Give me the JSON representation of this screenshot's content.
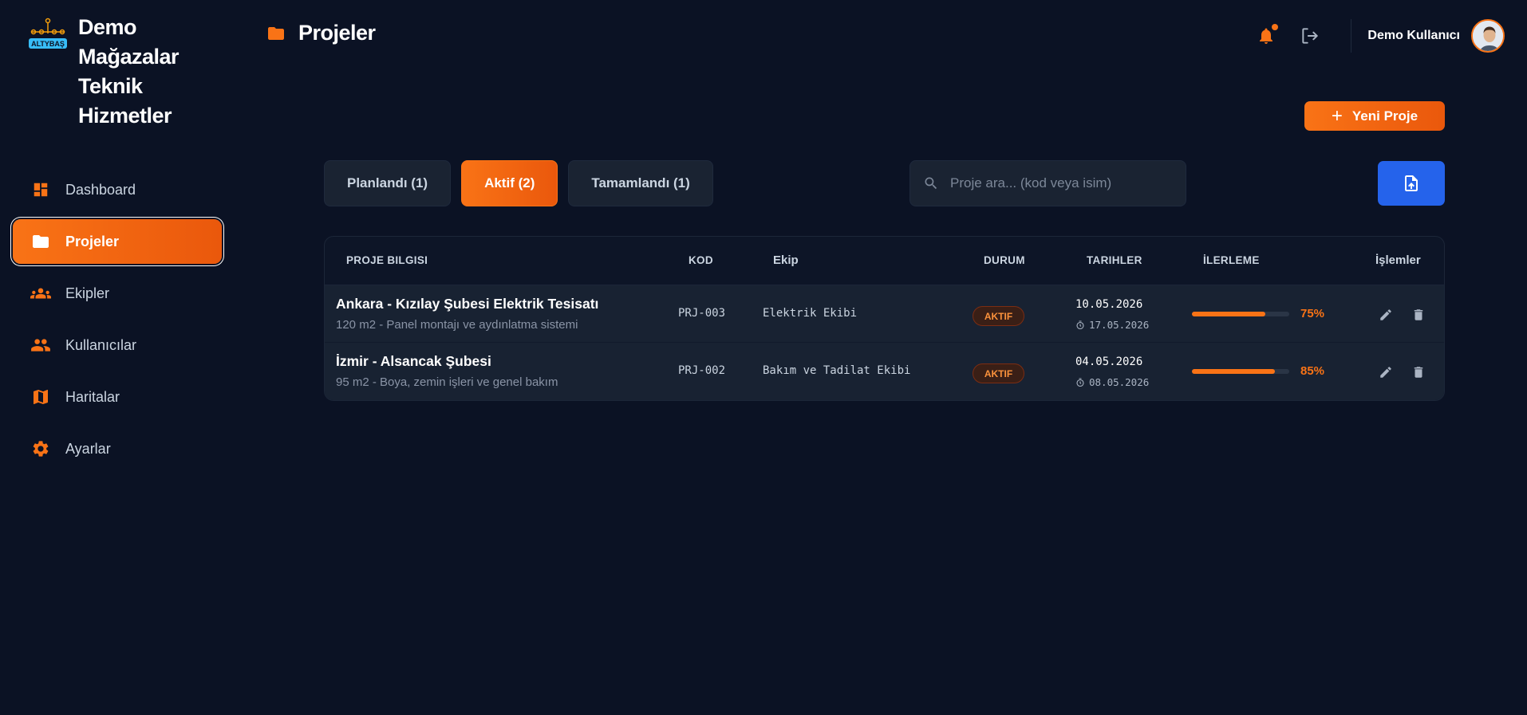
{
  "sidebar": {
    "logo_text": "ALTYBAŞ",
    "brand": "Demo Mağazalar Teknik Hizmetler",
    "items": [
      {
        "label": "Dashboard",
        "icon": "dashboard-icon",
        "active": false
      },
      {
        "label": "Projeler",
        "icon": "folder-icon",
        "active": true
      },
      {
        "label": "Ekipler",
        "icon": "groups-icon",
        "active": false
      },
      {
        "label": "Kullanıcılar",
        "icon": "people-icon",
        "active": false
      },
      {
        "label": "Haritalar",
        "icon": "map-icon",
        "active": false
      },
      {
        "label": "Ayarlar",
        "icon": "gear-icon",
        "active": false
      }
    ]
  },
  "header": {
    "title": "Projeler",
    "title_icon": "folder-icon",
    "user_name": "Demo Kullanıcı"
  },
  "main": {
    "new_button": "Yeni Proje",
    "tabs": [
      {
        "label": "Planlandı (1)",
        "active": false
      },
      {
        "label": "Aktif (2)",
        "active": true
      },
      {
        "label": "Tamamlandı (1)",
        "active": false
      }
    ],
    "search_placeholder": "Proje ara... (kod veya isim)",
    "table": {
      "headers": [
        "PROJE BILGISI",
        "KOD",
        "Ekip",
        "DURUM",
        "TARIHLER",
        "İLERLEME",
        "İşlemler"
      ],
      "rows": [
        {
          "title": "Ankara - Kızılay Şubesi Elektrik Tesisatı",
          "subtitle": "120 m2 - Panel montajı ve aydınlatma sistemi",
          "code": "PRJ-003",
          "team": "Elektrik Ekibi",
          "status": "AKTIF",
          "start": "10.05.2026",
          "end": "17.05.2026",
          "progress": 0.75,
          "progress_label": "75%"
        },
        {
          "title": "İzmir - Alsancak Şubesi",
          "subtitle": "95 m2 - Boya, zemin işleri ve genel bakım",
          "code": "PRJ-002",
          "team": "Bakım ve Tadilat Ekibi",
          "status": "AKTIF",
          "start": "04.05.2026",
          "end": "08.05.2026",
          "progress": 0.85,
          "progress_label": "85%"
        }
      ]
    }
  },
  "colors": {
    "background": "#0b1224",
    "accent": "#f97316",
    "upload_button": "#2563eb",
    "panel": "#1a2332"
  }
}
